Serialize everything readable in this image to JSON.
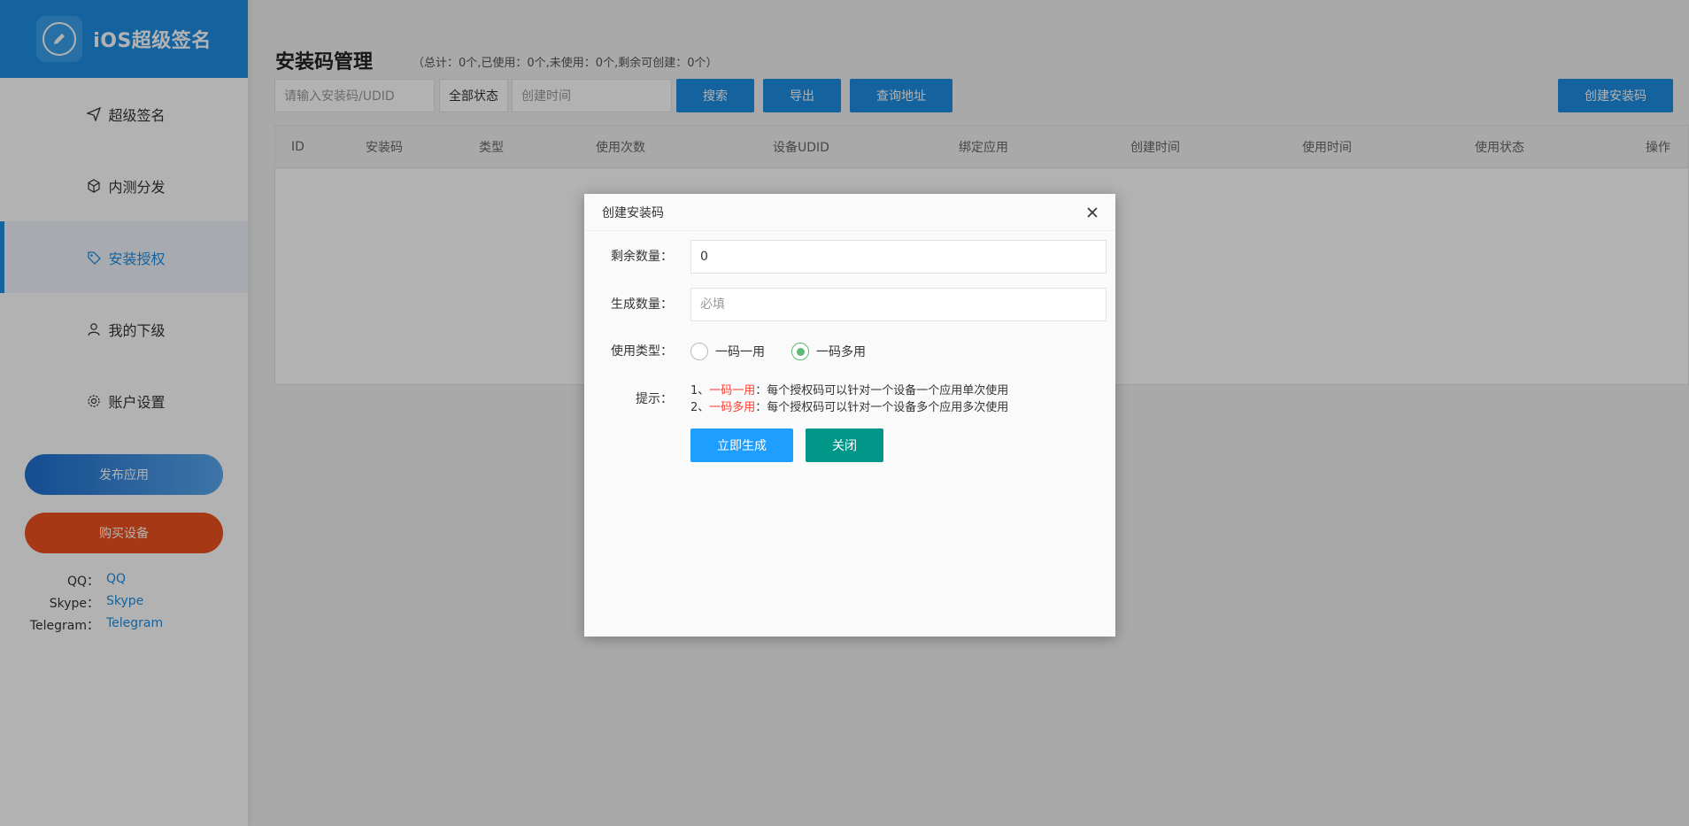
{
  "app": {
    "title": "iOS超级签名",
    "logo_icon": "pencil-circle-icon"
  },
  "sidebar": {
    "items": [
      {
        "label": "超级签名",
        "icon": "send-icon",
        "active": false
      },
      {
        "label": "内测分发",
        "icon": "cube-icon",
        "active": false
      },
      {
        "label": "安装授权",
        "icon": "tag-icon",
        "active": true
      },
      {
        "label": "我的下级",
        "icon": "user-icon",
        "active": false
      },
      {
        "label": "账户设置",
        "icon": "gear-icon",
        "active": false
      }
    ],
    "publish_label": "发布应用",
    "buy_label": "购买设备",
    "contacts": [
      {
        "key": "QQ：",
        "value": "QQ"
      },
      {
        "key": "Skype：",
        "value": "Skype"
      },
      {
        "key": "Telegram：",
        "value": "Telegram"
      }
    ]
  },
  "main": {
    "title": "安装码管理",
    "stats": "（总计：0个,已使用：0个,未使用：0个,剩余可创建：0个）",
    "search_placeholder": "请输入安装码/UDID",
    "status_select": "全部状态",
    "date_placeholder": "创建时间",
    "search_btn": "搜索",
    "export_btn": "导出",
    "query_btn": "查询地址",
    "create_btn": "创建安装码",
    "columns": [
      "ID",
      "安装码",
      "类型",
      "使用次数",
      "设备UDID",
      "绑定应用",
      "创建时间",
      "使用时间",
      "使用状态",
      "操作"
    ]
  },
  "modal": {
    "title": "创建安装码",
    "remaining_label": "剩余数量：",
    "remaining_value": "0",
    "generate_label": "生成数量：",
    "generate_placeholder": "必填",
    "type_label": "使用类型：",
    "type_options": [
      "一码一用",
      "一码多用"
    ],
    "type_selected": "一码多用",
    "tip_label": "提示：",
    "tip1_prefix": "1、",
    "tip1_key": "一码一用",
    "tip1_text": "：每个授权码可以针对一个设备一个应用单次使用",
    "tip2_prefix": "2、",
    "tip2_key": "一码多用",
    "tip2_text": "：每个授权码可以针对一个设备多个应用多次使用",
    "generate_btn": "立即生成",
    "close_btn": "关闭"
  },
  "colors": {
    "primary": "#1e8fe3",
    "orange": "#ef5120",
    "teal": "#009688",
    "green": "#5fb878",
    "red": "#ff3b30"
  }
}
